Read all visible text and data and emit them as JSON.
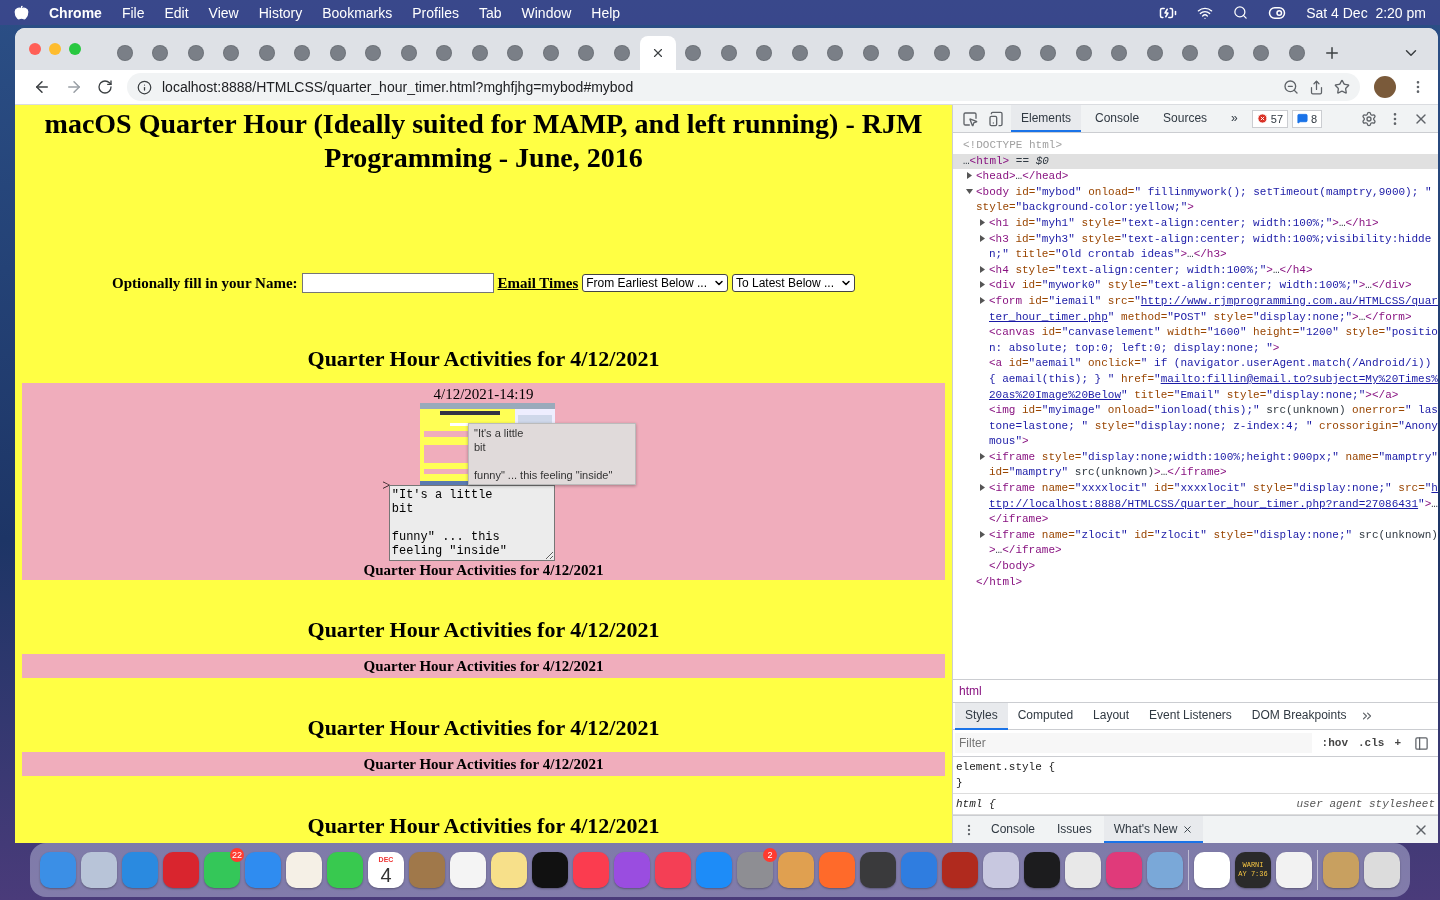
{
  "menu_bar": {
    "app": "Chrome",
    "items": [
      "File",
      "Edit",
      "View",
      "History",
      "Bookmarks",
      "Profiles",
      "Tab",
      "Window",
      "Help"
    ],
    "clock": "Sat 4 Dec  2:20 pm"
  },
  "browser": {
    "tabs": [
      {
        "selected": false
      },
      {
        "selected": false
      },
      {
        "selected": false
      },
      {
        "selected": false
      },
      {
        "selected": false
      },
      {
        "selected": false
      },
      {
        "selected": false
      },
      {
        "selected": false
      },
      {
        "selected": false
      },
      {
        "selected": false
      },
      {
        "selected": false
      },
      {
        "selected": false
      },
      {
        "selected": false
      },
      {
        "selected": false
      },
      {
        "selected": false
      },
      {
        "selected": true
      },
      {
        "selected": false
      },
      {
        "selected": false
      },
      {
        "selected": false
      },
      {
        "selected": false
      },
      {
        "selected": false
      },
      {
        "selected": false
      },
      {
        "selected": false
      },
      {
        "selected": false
      },
      {
        "selected": false
      },
      {
        "selected": false
      },
      {
        "selected": false
      },
      {
        "selected": false
      },
      {
        "selected": false
      },
      {
        "selected": false
      },
      {
        "selected": false
      },
      {
        "selected": false
      },
      {
        "selected": false
      },
      {
        "selected": false
      }
    ],
    "url": "localhost:8888/HTMLCSS/quarter_hour_timer.html?mghfjhg=mybod#mybod"
  },
  "page": {
    "title": "macOS Quarter Hour (Ideally suited for MAMP, and left running) - RJM Programming - June, 2016",
    "form": {
      "label": "Optionally fill in your Name:",
      "link": "Email Times",
      "selects": [
        "From Earliest Below ...",
        "To Latest Below ..."
      ]
    },
    "sections": [
      {
        "heading": "Quarter Hour Activities for 4/12/2021",
        "kind": "detail",
        "timestamp": "4/12/2021-14:19",
        "marker": ">",
        "note": "\"It's a little\nbit\n\nfunny\" ... this\nfeeling \"inside\"",
        "tooltip": "\"It's a little\nbit\n\nfunny\" ... this feeling \"inside\"",
        "caption": "Quarter Hour Activities for 4/12/2021"
      },
      {
        "heading": "Quarter Hour Activities for 4/12/2021",
        "kind": "summary",
        "caption": "Quarter Hour Activities for 4/12/2021"
      },
      {
        "heading": "Quarter Hour Activities for 4/12/2021",
        "kind": "summary",
        "caption": "Quarter Hour Activities for 4/12/2021"
      },
      {
        "heading": "Quarter Hour Activities for 4/12/2021",
        "kind": "heading_only"
      }
    ]
  },
  "devtools": {
    "tabs": [
      {
        "label": "Elements",
        "selected": true
      },
      {
        "label": "Console",
        "selected": false
      },
      {
        "label": "Sources",
        "selected": false
      }
    ],
    "more": "»",
    "errors": "57",
    "messages": "8",
    "tree": [
      {
        "kind": "leaf",
        "selected": false,
        "tokens": [
          {
            "kind": "dim",
            "t": "<!DOCTYPE html>"
          }
        ]
      },
      {
        "kind": "leaf",
        "selected": true,
        "tokens": [
          {
            "kind": "txt",
            "t": "…"
          },
          {
            "kind": "tag",
            "t": "<html>"
          },
          {
            "kind": "txt",
            "t": " == "
          },
          {
            "kind": "var",
            "t": "$0"
          }
        ],
        "close": [
          {
            "kind": "tag",
            "t": "</html>"
          }
        ],
        "children": [
          {
            "kind": "branch",
            "expanded": false,
            "selected": false,
            "tokens": [
              {
                "kind": "tag",
                "t": "<head>"
              },
              {
                "kind": "txt",
                "t": "…"
              },
              {
                "kind": "tag",
                "t": "</head>"
              }
            ]
          },
          {
            "kind": "branch",
            "expanded": true,
            "selected": false,
            "tokens": [
              {
                "kind": "tag",
                "t": "<body"
              },
              {
                "kind": "attr",
                "t": " id="
              },
              {
                "kind": "val",
                "t": "\"mybod\""
              },
              {
                "kind": "attr",
                "t": " onload="
              },
              {
                "kind": "val",
                "t": "\" fillinmywork(); setTimeout(mamptry,9000); \""
              },
              {
                "kind": "attr",
                "t": " style="
              },
              {
                "kind": "val",
                "t": "\"background-color:yellow;\""
              },
              {
                "kind": "tag",
                "t": ">"
              }
            ],
            "close": [
              {
                "kind": "tag",
                "t": "</body>"
              }
            ],
            "children": [
              {
                "kind": "branch",
                "expanded": false,
                "selected": false,
                "tokens": [
                  {
                    "kind": "tag",
                    "t": "<h1"
                  },
                  {
                    "kind": "attr",
                    "t": " id="
                  },
                  {
                    "kind": "val",
                    "t": "\"myh1\""
                  },
                  {
                    "kind": "attr",
                    "t": " style="
                  },
                  {
                    "kind": "val",
                    "t": "\"text-align:center; width:100%;\""
                  },
                  {
                    "kind": "tag",
                    "t": ">"
                  },
                  {
                    "kind": "txt",
                    "t": "…"
                  },
                  {
                    "kind": "tag",
                    "t": "</h1>"
                  }
                ]
              },
              {
                "kind": "branch",
                "expanded": false,
                "selected": false,
                "tokens": [
                  {
                    "kind": "tag",
                    "t": "<h3"
                  },
                  {
                    "kind": "attr",
                    "t": " id="
                  },
                  {
                    "kind": "val",
                    "t": "\"myh3\""
                  },
                  {
                    "kind": "attr",
                    "t": " style="
                  },
                  {
                    "kind": "val",
                    "t": "\"text-align:center; width:100%;visibility:hidden;\""
                  },
                  {
                    "kind": "attr",
                    "t": " title="
                  },
                  {
                    "kind": "val",
                    "t": "\"Old crontab ideas\""
                  },
                  {
                    "kind": "tag",
                    "t": ">"
                  },
                  {
                    "kind": "txt",
                    "t": "…"
                  },
                  {
                    "kind": "tag",
                    "t": "</h3>"
                  }
                ]
              },
              {
                "kind": "branch",
                "expanded": false,
                "selected": false,
                "tokens": [
                  {
                    "kind": "tag",
                    "t": "<h4"
                  },
                  {
                    "kind": "attr",
                    "t": " style="
                  },
                  {
                    "kind": "val",
                    "t": "\"text-align:center; width:100%;\""
                  },
                  {
                    "kind": "tag",
                    "t": ">"
                  },
                  {
                    "kind": "txt",
                    "t": "…"
                  },
                  {
                    "kind": "tag",
                    "t": "</h4>"
                  }
                ]
              },
              {
                "kind": "branch",
                "expanded": false,
                "selected": false,
                "tokens": [
                  {
                    "kind": "tag",
                    "t": "<div"
                  },
                  {
                    "kind": "attr",
                    "t": " id="
                  },
                  {
                    "kind": "val",
                    "t": "\"mywork0\""
                  },
                  {
                    "kind": "attr",
                    "t": " style="
                  },
                  {
                    "kind": "val",
                    "t": "\"text-align:center; width:100%;\""
                  },
                  {
                    "kind": "tag",
                    "t": ">"
                  },
                  {
                    "kind": "txt",
                    "t": "…"
                  },
                  {
                    "kind": "tag",
                    "t": "</div>"
                  }
                ]
              },
              {
                "kind": "branch",
                "expanded": false,
                "selected": false,
                "tokens": [
                  {
                    "kind": "tag",
                    "t": "<form"
                  },
                  {
                    "kind": "attr",
                    "t": " id="
                  },
                  {
                    "kind": "val",
                    "t": "\"iemail\""
                  },
                  {
                    "kind": "attr",
                    "t": " src="
                  },
                  {
                    "kind": "val",
                    "t": "\""
                  },
                  {
                    "kind": "link",
                    "t": "http://www.rjmprogramming.com.au/HTMLCSS/quarter_hour_timer.php"
                  },
                  {
                    "kind": "val",
                    "t": "\""
                  },
                  {
                    "kind": "attr",
                    "t": " method="
                  },
                  {
                    "kind": "val",
                    "t": "\"POST\""
                  },
                  {
                    "kind": "attr",
                    "t": " style="
                  },
                  {
                    "kind": "val",
                    "t": "\"display:none;\""
                  },
                  {
                    "kind": "tag",
                    "t": ">"
                  },
                  {
                    "kind": "txt",
                    "t": "…"
                  },
                  {
                    "kind": "tag",
                    "t": "</form>"
                  }
                ]
              },
              {
                "kind": "leaf",
                "selected": false,
                "tokens": [
                  {
                    "kind": "tag",
                    "t": "<canvas"
                  },
                  {
                    "kind": "attr",
                    "t": " id="
                  },
                  {
                    "kind": "val",
                    "t": "\"canvaselement\""
                  },
                  {
                    "kind": "attr",
                    "t": " width="
                  },
                  {
                    "kind": "val",
                    "t": "\"1600\""
                  },
                  {
                    "kind": "attr",
                    "t": " height="
                  },
                  {
                    "kind": "val",
                    "t": "\"1200\""
                  },
                  {
                    "kind": "attr",
                    "t": " style="
                  },
                  {
                    "kind": "val",
                    "t": "\"position: absolute; top:0; left:0; display:none; \""
                  },
                  {
                    "kind": "tag",
                    "t": ">"
                  }
                ]
              },
              {
                "kind": "leaf",
                "selected": false,
                "tokens": [
                  {
                    "kind": "tag",
                    "t": "<a"
                  },
                  {
                    "kind": "attr",
                    "t": " id="
                  },
                  {
                    "kind": "val",
                    "t": "\"aemail\""
                  },
                  {
                    "kind": "attr",
                    "t": " onclick="
                  },
                  {
                    "kind": "val",
                    "t": "\" if (navigator.userAgent.match(/Android/i)) { aemail(this); } \""
                  },
                  {
                    "kind": "attr",
                    "t": " href="
                  },
                  {
                    "kind": "val",
                    "t": "\""
                  },
                  {
                    "kind": "link",
                    "t": "mailto:fillin@email.to?subject=My%20Times%20as%20Image%20Below"
                  },
                  {
                    "kind": "val",
                    "t": "\""
                  },
                  {
                    "kind": "attr",
                    "t": " title="
                  },
                  {
                    "kind": "val",
                    "t": "\"Email\""
                  },
                  {
                    "kind": "attr",
                    "t": " style="
                  },
                  {
                    "kind": "val",
                    "t": "\"display:none;\""
                  },
                  {
                    "kind": "tag",
                    "t": "></a>"
                  }
                ]
              },
              {
                "kind": "leaf",
                "selected": false,
                "tokens": [
                  {
                    "kind": "tag",
                    "t": "<img"
                  },
                  {
                    "kind": "attr",
                    "t": " id="
                  },
                  {
                    "kind": "val",
                    "t": "\"myimage\""
                  },
                  {
                    "kind": "attr",
                    "t": " onload="
                  },
                  {
                    "kind": "val",
                    "t": "\"ionload(this);\""
                  },
                  {
                    "kind": "txt",
                    "t": " src(unknown)"
                  },
                  {
                    "kind": "attr",
                    "t": " onerror="
                  },
                  {
                    "kind": "val",
                    "t": "\" lastone=lastone; \""
                  },
                  {
                    "kind": "attr",
                    "t": " style="
                  },
                  {
                    "kind": "val",
                    "t": "\"display:none; z-index:4; \""
                  },
                  {
                    "kind": "attr",
                    "t": " crossorigin="
                  },
                  {
                    "kind": "val",
                    "t": "\"Anonymous\""
                  },
                  {
                    "kind": "tag",
                    "t": ">"
                  }
                ]
              },
              {
                "kind": "branch",
                "expanded": false,
                "selected": false,
                "tokens": [
                  {
                    "kind": "tag",
                    "t": "<iframe"
                  },
                  {
                    "kind": "attr",
                    "t": " style="
                  },
                  {
                    "kind": "val",
                    "t": "\"display:none;width:100%;height:900px;\""
                  },
                  {
                    "kind": "attr",
                    "t": " name="
                  },
                  {
                    "kind": "val",
                    "t": "\"mamptry\""
                  },
                  {
                    "kind": "attr",
                    "t": " id="
                  },
                  {
                    "kind": "val",
                    "t": "\"mamptry\""
                  },
                  {
                    "kind": "txt",
                    "t": " src(unknown)"
                  },
                  {
                    "kind": "tag",
                    "t": ">"
                  },
                  {
                    "kind": "txt",
                    "t": "…"
                  },
                  {
                    "kind": "tag",
                    "t": "</iframe>"
                  }
                ]
              },
              {
                "kind": "branch",
                "expanded": false,
                "selected": false,
                "tokens": [
                  {
                    "kind": "tag",
                    "t": "<iframe"
                  },
                  {
                    "kind": "attr",
                    "t": " name="
                  },
                  {
                    "kind": "val",
                    "t": "\"xxxxlocit\""
                  },
                  {
                    "kind": "attr",
                    "t": " id="
                  },
                  {
                    "kind": "val",
                    "t": "\"xxxxlocit\""
                  },
                  {
                    "kind": "attr",
                    "t": " style="
                  },
                  {
                    "kind": "val",
                    "t": "\"display:none;\""
                  },
                  {
                    "kind": "attr",
                    "t": " src="
                  },
                  {
                    "kind": "val",
                    "t": "\""
                  },
                  {
                    "kind": "link",
                    "t": "http://localhost:8888/HTMLCSS/quarter_hour_timer.php?rand=27086431"
                  },
                  {
                    "kind": "val",
                    "t": "\""
                  },
                  {
                    "kind": "tag",
                    "t": ">"
                  },
                  {
                    "kind": "txt",
                    "t": "…"
                  },
                  {
                    "kind": "tag",
                    "t": "</iframe>"
                  }
                ]
              },
              {
                "kind": "branch",
                "expanded": false,
                "selected": false,
                "tokens": [
                  {
                    "kind": "tag",
                    "t": "<iframe"
                  },
                  {
                    "kind": "attr",
                    "t": " name="
                  },
                  {
                    "kind": "val",
                    "t": "\"zlocit\""
                  },
                  {
                    "kind": "attr",
                    "t": " id="
                  },
                  {
                    "kind": "val",
                    "t": "\"zlocit\""
                  },
                  {
                    "kind": "attr",
                    "t": " style="
                  },
                  {
                    "kind": "val",
                    "t": "\"display:none;\""
                  },
                  {
                    "kind": "txt",
                    "t": " src(unknown)"
                  },
                  {
                    "kind": "tag",
                    "t": ">"
                  },
                  {
                    "kind": "txt",
                    "t": "…"
                  },
                  {
                    "kind": "tag",
                    "t": "</iframe>"
                  }
                ]
              }
            ]
          }
        ]
      }
    ],
    "breadcrumb": "html",
    "style_tabs": [
      {
        "label": "Styles",
        "selected": true
      },
      {
        "label": "Computed",
        "selected": false
      },
      {
        "label": "Layout",
        "selected": false
      },
      {
        "label": "Event Listeners",
        "selected": false
      },
      {
        "label": "DOM Breakpoints",
        "selected": false
      }
    ],
    "filter": {
      "placeholder": "Filter",
      "hov": ":hov",
      "cls": ".cls",
      "add": "+"
    },
    "rules": [
      {
        "selector": "element.style {",
        "close": "}"
      },
      {
        "selector": "html {",
        "origin": "user agent stylesheet"
      }
    ],
    "drawer_tabs": [
      {
        "label": "Console",
        "selected": false
      },
      {
        "label": "Issues",
        "selected": false
      },
      {
        "label": "What's New",
        "selected": true
      }
    ]
  },
  "dock": [
    {
      "kind": "app",
      "color": "#3b8fe6"
    },
    {
      "kind": "app",
      "color": "#b8c4d8"
    },
    {
      "kind": "app",
      "color": "#2a8ae0"
    },
    {
      "kind": "app",
      "color": "#d9252e"
    },
    {
      "kind": "app",
      "color": "#34c759",
      "badge": "22"
    },
    {
      "kind": "app",
      "color": "#2f8cf0"
    },
    {
      "kind": "app",
      "color": "#f5f0e6"
    },
    {
      "kind": "app",
      "color": "#38c94f"
    },
    {
      "kind": "calendar",
      "color": "#ffffff",
      "month": "DEC",
      "day": "4"
    },
    {
      "kind": "app",
      "color": "#a0784a"
    },
    {
      "kind": "app",
      "color": "#f4f4f4"
    },
    {
      "kind": "app",
      "color": "#f7e08a"
    },
    {
      "kind": "app",
      "color": "#111111"
    },
    {
      "kind": "app",
      "color": "#fb3c4f"
    },
    {
      "kind": "app",
      "color": "#9a4de0"
    },
    {
      "kind": "app",
      "color": "#f43f55"
    },
    {
      "kind": "app",
      "color": "#1d8cf8"
    },
    {
      "kind": "app",
      "color": "#8e8e93",
      "badge": "2"
    },
    {
      "kind": "app",
      "color": "#e0a050"
    },
    {
      "kind": "app",
      "color": "#ff6a2a"
    },
    {
      "kind": "app",
      "color": "#3a3a3c"
    },
    {
      "kind": "app",
      "color": "#2f7de0"
    },
    {
      "kind": "app",
      "color": "#b02a1e"
    },
    {
      "kind": "app",
      "color": "#c8c8e0"
    },
    {
      "kind": "app",
      "color": "#1c1c1e"
    },
    {
      "kind": "app",
      "color": "#e8e8e8"
    },
    {
      "kind": "app",
      "color": "#e03a7a"
    },
    {
      "kind": "app",
      "color": "#7aa8d8"
    },
    {
      "kind": "separator"
    },
    {
      "kind": "app",
      "color": "#ffffff"
    },
    {
      "kind": "console",
      "color": "#2a2a2a",
      "lines": [
        "WARNI",
        "AY 7:36"
      ]
    },
    {
      "kind": "app",
      "color": "#f2f2f2"
    },
    {
      "kind": "separator"
    },
    {
      "kind": "app",
      "color": "#c8a060"
    },
    {
      "kind": "app",
      "color": "#dcdcdc"
    }
  ]
}
